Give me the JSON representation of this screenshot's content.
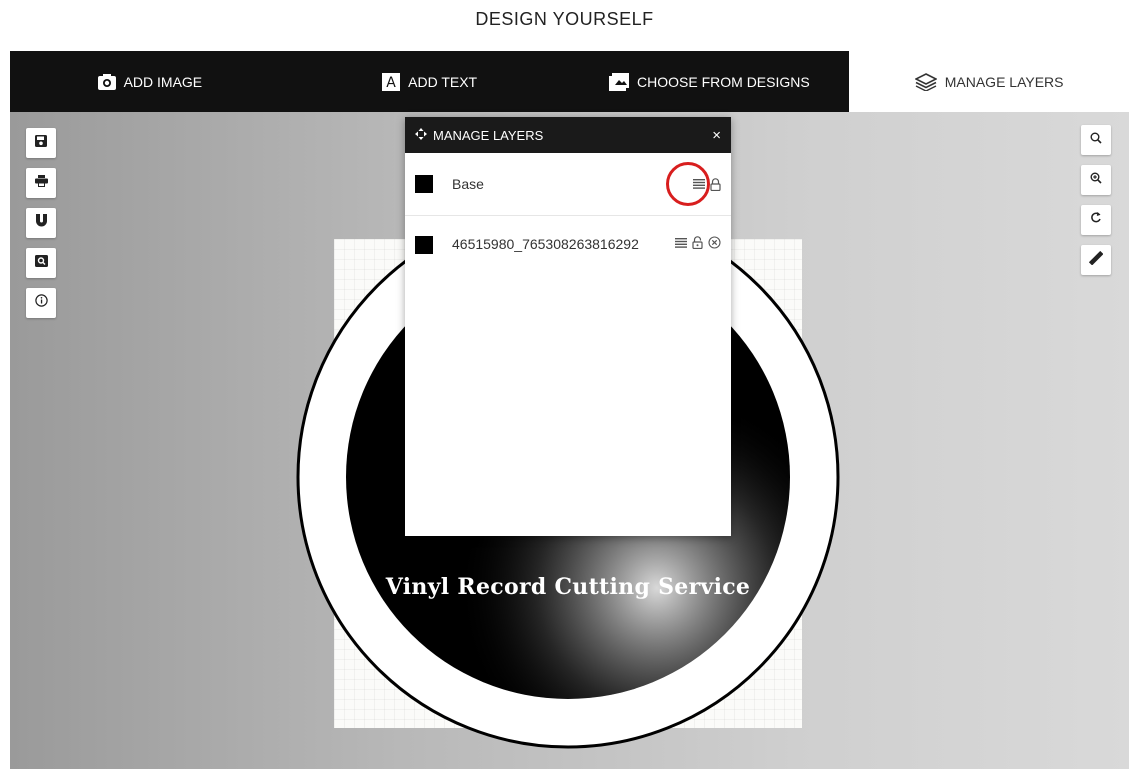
{
  "page": {
    "title": "DESIGN YOURSELF"
  },
  "tabs": [
    {
      "label": "ADD IMAGE",
      "icon": "camera-icon"
    },
    {
      "label": "ADD TEXT",
      "icon": "text-a-icon"
    },
    {
      "label": "CHOOSE FROM DESIGNS",
      "icon": "image-gallery-icon"
    },
    {
      "label": "MANAGE LAYERS",
      "icon": "layers-icon",
      "active": true
    }
  ],
  "left_toolbar": [
    "save-icon",
    "print-icon",
    "magnet-icon",
    "search-image-icon",
    "info-icon"
  ],
  "right_toolbar": [
    "zoom-out-icon",
    "zoom-in-icon",
    "rotate-icon",
    "ruler-icon"
  ],
  "canvas": {
    "artwork_text": "Vinyl Record Cutting Service"
  },
  "layers_panel": {
    "title": "MANAGE LAYERS",
    "close": "×",
    "layers": [
      {
        "name": "Base",
        "color": "#000000",
        "actions": [
          "reorder-icon",
          "lock-icon"
        ]
      },
      {
        "name": "46515980_765308263816292",
        "color": "#000000",
        "actions": [
          "reorder-icon",
          "unlock-icon",
          "delete-icon"
        ]
      }
    ]
  },
  "colors": {
    "highlight": "#d81e1e",
    "tabbar": "#111111"
  }
}
